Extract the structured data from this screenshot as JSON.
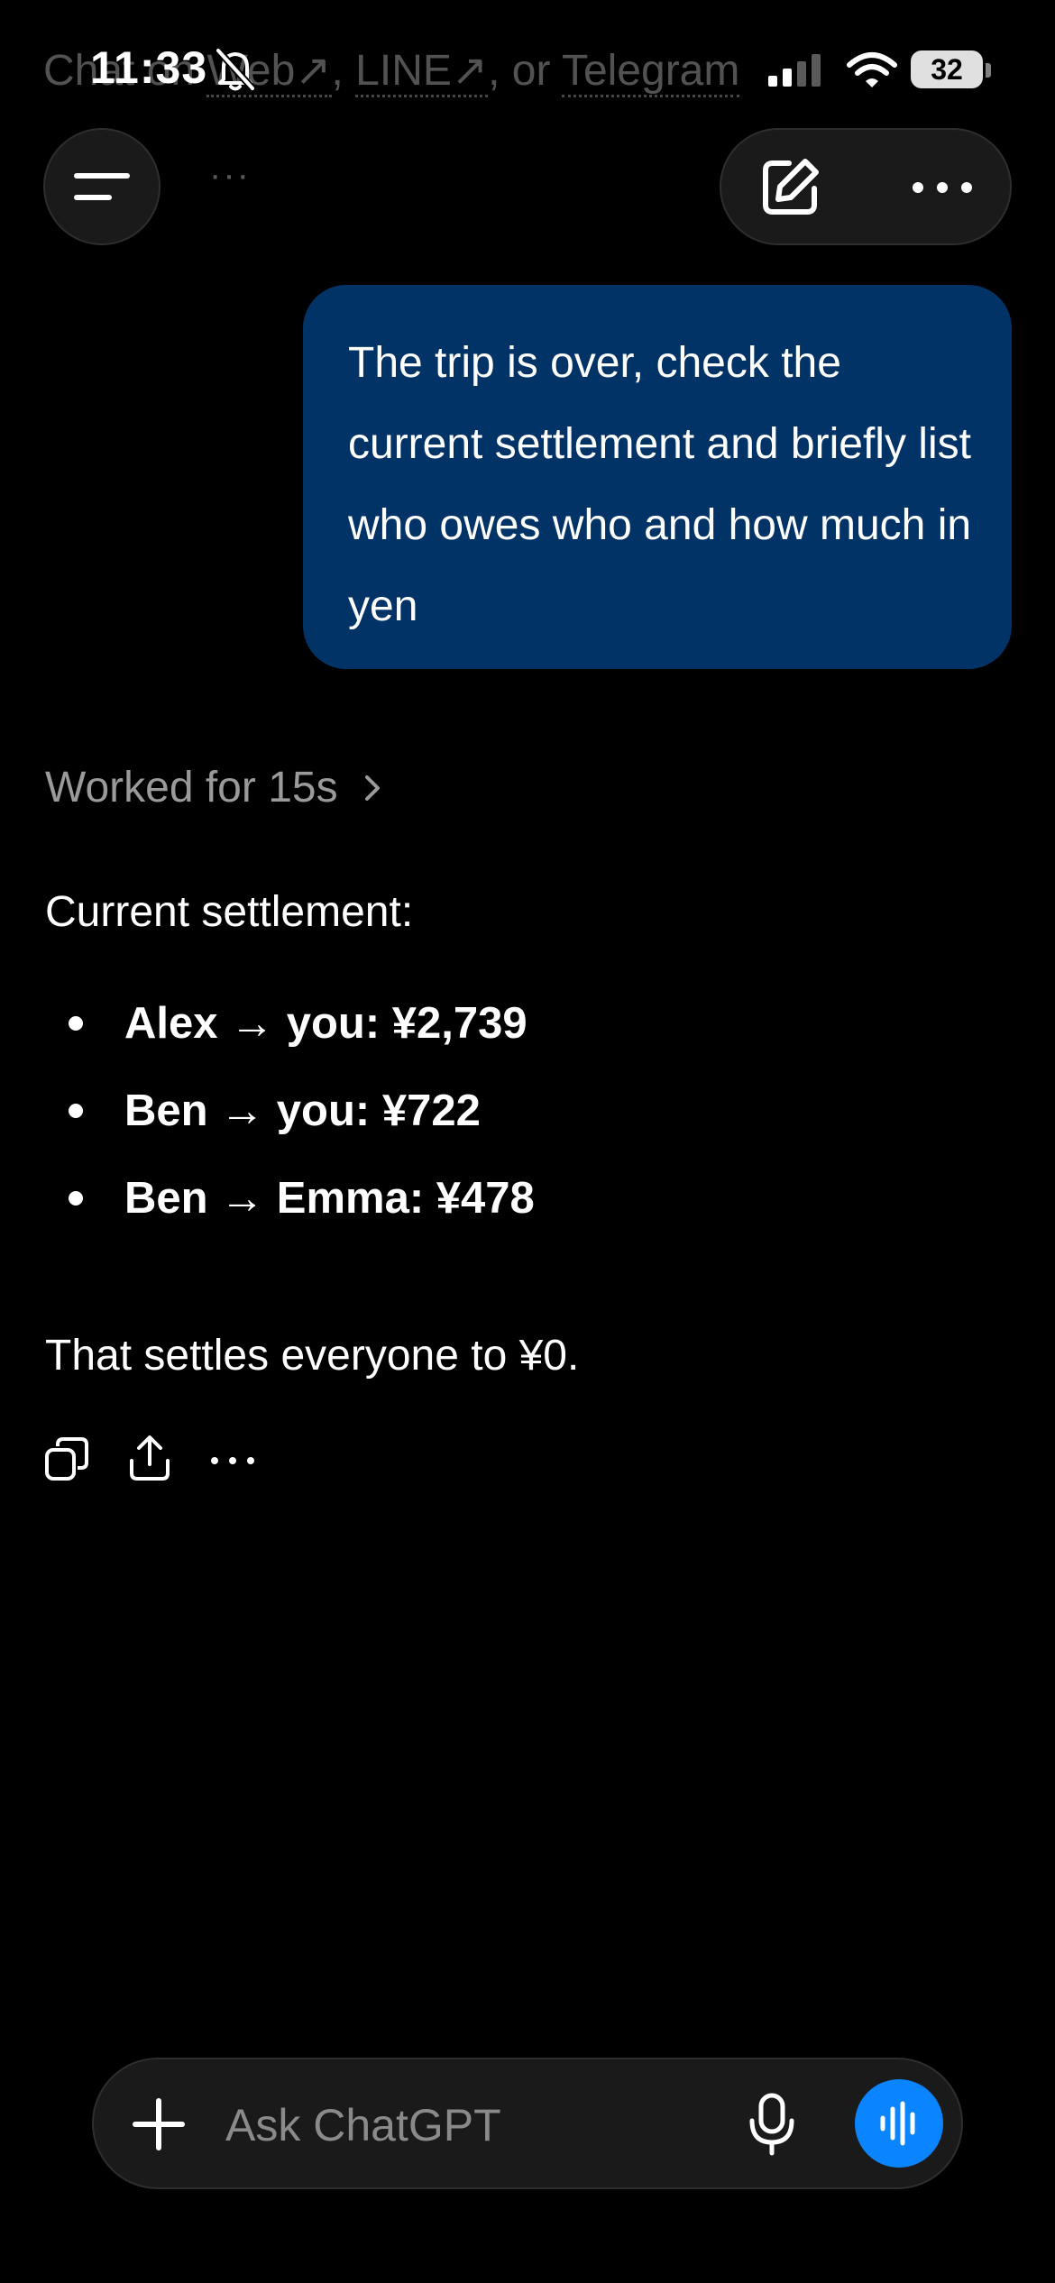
{
  "background_text": {
    "part1": "Ch",
    "part2": "at on ",
    "link_web": "Web↗",
    "sep1": ", ",
    "link_line": "LINE↗",
    "sep2": ", or ",
    "link_telegram": "Telegram",
    "dots": "···"
  },
  "status_bar": {
    "time": "11:33",
    "battery": "32",
    "icons": [
      "bell-slash-icon",
      "cellular-signal-icon",
      "wifi-icon",
      "battery-icon"
    ]
  },
  "header": {
    "menu_icon": "menu-icon",
    "compose_icon": "compose-icon",
    "more_icon": "more-icon"
  },
  "conversation": {
    "user_message": "The trip is over, check the current settlement and briefly list who owes who and how much in yen",
    "assistant": {
      "worked_label": "Worked for 15s",
      "heading": "Current settlement:",
      "items": [
        "Alex → you: ¥2,739",
        "Ben → you: ¥722",
        "Ben → Emma: ¥478"
      ],
      "closing": "That settles everyone to ¥0."
    },
    "actions": [
      "copy-icon",
      "share-icon",
      "more-icon"
    ]
  },
  "composer": {
    "placeholder": "Ask ChatGPT",
    "value": "",
    "accent_color": "#0a84ff"
  },
  "colors": {
    "background": "#000000",
    "user_bubble": "#013367",
    "muted_text": "#9a9a9a"
  }
}
